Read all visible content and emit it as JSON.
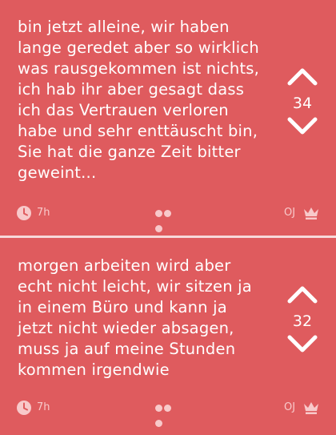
{
  "posts": [
    {
      "text": "bin jetzt alleine, wir haben\nlange geredet aber so wirklich\nwas rausgekommen ist nichts,\nich hab ihr aber gesagt dass\nich das Vertrauen verloren\nhabe und sehr enttäuscht bin,\nSie hat die ganze Zeit bitter\ngeweint...",
      "votes": "34",
      "time": "7h",
      "author": "OJ",
      "icons": {
        "upvote": "chevron-up-icon",
        "downvote": "chevron-down-icon",
        "time": "clock-icon",
        "more": "more-dots-icon",
        "author": "crown-icon"
      }
    },
    {
      "text": "morgen arbeiten wird aber\necht nicht leicht, wir sitzen ja\nin einem Büro und kann ja\njetzt nicht wieder absagen,\nmuss ja auf meine Stunden\nkommen irgendwie",
      "votes": "32",
      "time": "7h",
      "author": "OJ",
      "icons": {
        "upvote": "chevron-up-icon",
        "downvote": "chevron-down-icon",
        "time": "clock-icon",
        "more": "more-dots-icon",
        "author": "crown-icon"
      }
    }
  ],
  "colors": {
    "background": "#df5b5e",
    "divider": "#f7d9da",
    "text": "#ffffff",
    "meta": "#f8c9ca"
  }
}
